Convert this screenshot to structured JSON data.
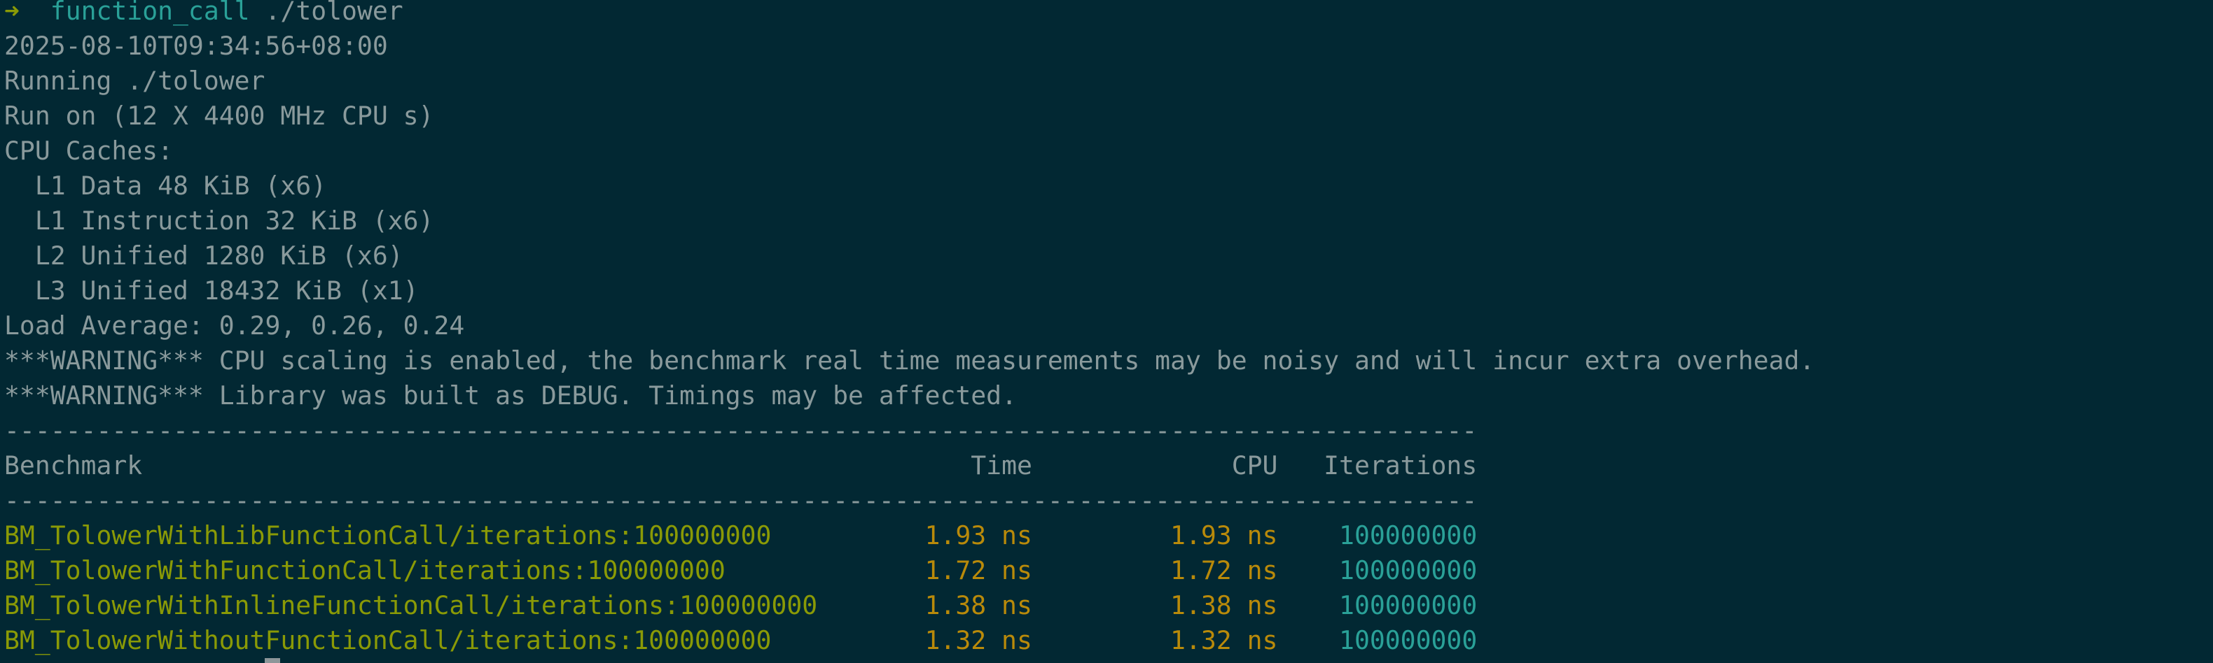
{
  "prompt": {
    "arrow": "➜",
    "directory": "function_call",
    "command": "./tolower"
  },
  "output": [
    "2025-08-10T09:34:56+08:00",
    "Running ./tolower",
    "Run on (12 X 4400 MHz CPU s)",
    "CPU Caches:",
    "  L1 Data 48 KiB (x6)",
    "  L1 Instruction 32 KiB (x6)",
    "  L2 Unified 1280 KiB (x6)",
    "  L3 Unified 18432 KiB (x1)",
    "Load Average: 0.29, 0.26, 0.24",
    "***WARNING*** CPU scaling is enabled, the benchmark real time measurements may be noisy and will incur extra overhead.",
    "***WARNING*** Library was built as DEBUG. Timings may be affected."
  ],
  "separator": "------------------------------------------------------------------------------------------------",
  "table": {
    "headers": {
      "benchmark": "Benchmark",
      "time": "Time",
      "cpu": "CPU",
      "iterations": "Iterations"
    },
    "rows": [
      {
        "name": "BM_TolowerWithLibFunctionCall/iterations:100000000",
        "time": "1.93 ns",
        "cpu": "1.93 ns",
        "iterations": "100000000"
      },
      {
        "name": "BM_TolowerWithFunctionCall/iterations:100000000",
        "time": "1.72 ns",
        "cpu": "1.72 ns",
        "iterations": "100000000"
      },
      {
        "name": "BM_TolowerWithInlineFunctionCall/iterations:100000000",
        "time": "1.38 ns",
        "cpu": "1.38 ns",
        "iterations": "100000000"
      },
      {
        "name": "BM_TolowerWithoutFunctionCall/iterations:100000000",
        "time": "1.32 ns",
        "cpu": "1.32 ns",
        "iterations": "100000000"
      }
    ]
  },
  "colors": {
    "background": "#022833",
    "text": "#8a9a9c",
    "name": "#8a9a06",
    "time": "#b98a0a",
    "iterations": "#2aa198"
  }
}
